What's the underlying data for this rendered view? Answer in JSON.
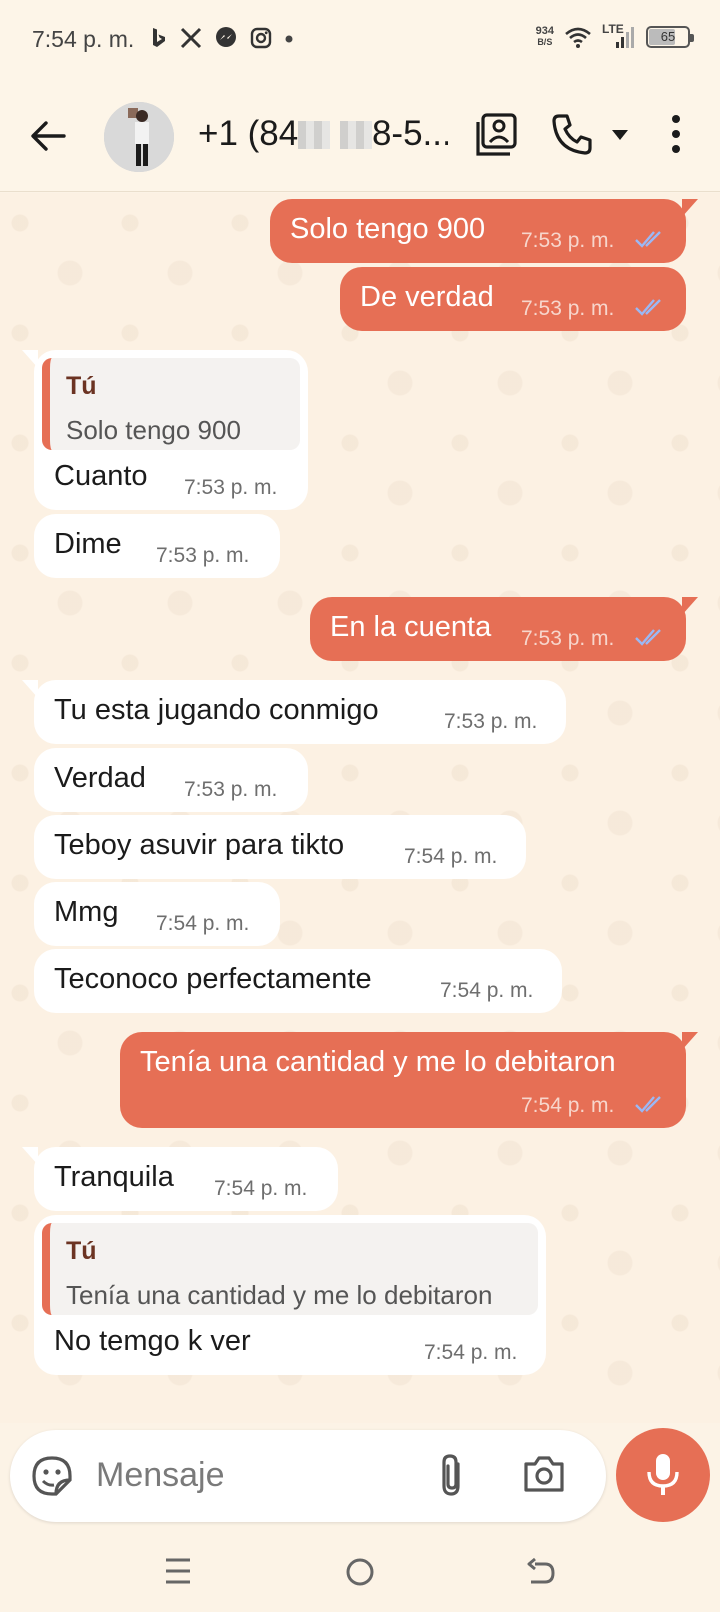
{
  "status_bar": {
    "time": "7:54 p. m.",
    "net_speed": "934",
    "net_speed_unit": "B/S",
    "network_type": "LTE",
    "battery": "65",
    "app_icons": [
      "bing-icon",
      "x-icon",
      "messenger-icon",
      "instagram-icon",
      "dot-icon"
    ]
  },
  "header": {
    "contact_name_start": "+1 (84",
    "contact_name_end": "8-5..."
  },
  "colors": {
    "outgoing_bubble": "#e66f55",
    "incoming_bubble": "#ffffff",
    "read_ticks": "#9bb8f5",
    "background": "#fcf1e3"
  },
  "messages": [
    {
      "dir": "out",
      "text": "Solo tengo 900",
      "time": "7:53 p. m."
    },
    {
      "dir": "out",
      "text": "De verdad",
      "time": "7:53 p. m."
    },
    {
      "dir": "in",
      "quote_author": "Tú",
      "quote_text": "Solo tengo 900",
      "text": "Cuanto",
      "time": "7:53 p. m."
    },
    {
      "dir": "in",
      "text": "Dime",
      "time": "7:53 p. m."
    },
    {
      "dir": "out",
      "text": "En la cuenta",
      "time": "7:53 p. m."
    },
    {
      "dir": "in",
      "text": "Tu esta jugando conmigo",
      "time": "7:53 p. m."
    },
    {
      "dir": "in",
      "text": "Verdad",
      "time": "7:53 p. m."
    },
    {
      "dir": "in",
      "text": "Teboy asuvir para tikto",
      "time": "7:54 p. m."
    },
    {
      "dir": "in",
      "text": "Mmg",
      "time": "7:54 p. m."
    },
    {
      "dir": "in",
      "text": "Teconoco perfectamente",
      "time": "7:54 p. m."
    },
    {
      "dir": "out",
      "text": "Tenía una cantidad y me lo debitaron",
      "time": "7:54 p. m."
    },
    {
      "dir": "in",
      "text": "Tranquila",
      "time": "7:54 p. m."
    },
    {
      "dir": "in",
      "quote_author": "Tú",
      "quote_text": "Tenía una cantidad y me lo debitaron",
      "text": "No temgo k ver",
      "time": "7:54 p. m."
    }
  ],
  "composer": {
    "placeholder": "Mensaje"
  }
}
